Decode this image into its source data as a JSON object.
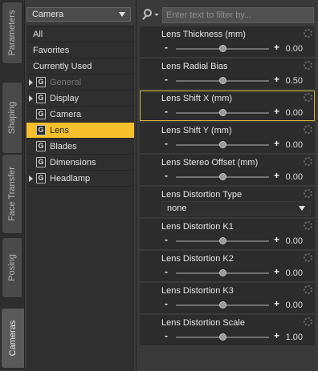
{
  "side_tabs": [
    {
      "label": "Parameters",
      "active": false
    },
    {
      "label": "Shaping",
      "active": false
    },
    {
      "label": "Face Transfer",
      "active": false
    },
    {
      "label": "Posing",
      "active": false
    },
    {
      "label": "Cameras",
      "active": true
    }
  ],
  "node_select": {
    "value": "Camera"
  },
  "categories": [
    {
      "label": "All",
      "type": "plain"
    },
    {
      "label": "Favorites",
      "type": "plain"
    },
    {
      "label": "Currently Used",
      "type": "plain"
    },
    {
      "label": "General",
      "type": "group",
      "expandable": true,
      "disabled": true
    },
    {
      "label": "Display",
      "type": "group",
      "expandable": true
    },
    {
      "label": "Camera",
      "type": "group"
    },
    {
      "label": "Lens",
      "type": "group",
      "selected": true
    },
    {
      "label": "Blades",
      "type": "group"
    },
    {
      "label": "Dimensions",
      "type": "group"
    },
    {
      "label": "Headlamp",
      "type": "group",
      "expandable": true
    }
  ],
  "group_icon_letter": "G",
  "filter": {
    "placeholder": "Enter text to filter by..."
  },
  "slider_symbols": {
    "minus": "-",
    "plus": "+"
  },
  "properties": [
    {
      "label": "Lens Thickness (mm)",
      "kind": "slider",
      "value": "0.00",
      "position": 0.5
    },
    {
      "label": "Lens Radial Bias",
      "kind": "slider",
      "value": "0.50",
      "position": 0.5
    },
    {
      "label": "Lens Shift X (mm)",
      "kind": "slider",
      "value": "0.00",
      "position": 0.5,
      "highlight": true
    },
    {
      "label": "Lens Shift Y (mm)",
      "kind": "slider",
      "value": "0.00",
      "position": 0.5
    },
    {
      "label": "Lens Stereo Offset (mm)",
      "kind": "slider",
      "value": "0.00",
      "position": 0.5
    },
    {
      "label": "Lens Distortion Type",
      "kind": "dropdown",
      "value": "none"
    },
    {
      "label": "Lens Distortion K1",
      "kind": "slider",
      "value": "0.00",
      "position": 0.5
    },
    {
      "label": "Lens Distortion K2",
      "kind": "slider",
      "value": "0.00",
      "position": 0.5
    },
    {
      "label": "Lens Distortion K3",
      "kind": "slider",
      "value": "0.00",
      "position": 0.5
    },
    {
      "label": "Lens Distortion Scale",
      "kind": "slider",
      "value": "1.00",
      "position": 0.5
    }
  ],
  "colors": {
    "accent": "#f7c02a",
    "highlight_border": "#d9b43a"
  }
}
